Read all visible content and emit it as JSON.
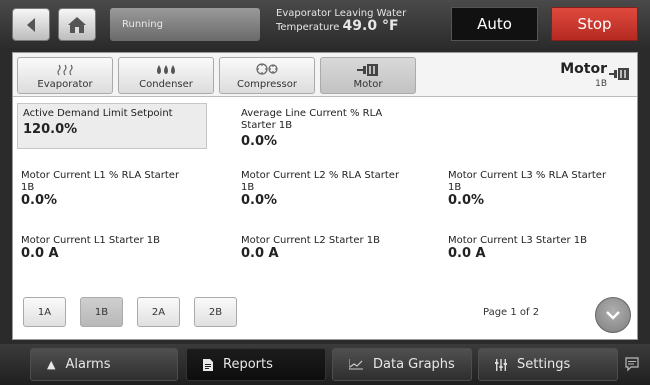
{
  "topbar": {
    "status": "Running",
    "evap_label_line1": "Evaporator Leaving Water",
    "evap_label_line2": "Temperature",
    "evap_value": "49.0 °F",
    "auto_label": "Auto",
    "stop_label": "Stop",
    "stop_color": "#cc3a30"
  },
  "tabs": [
    {
      "label": "Evaporator",
      "icon": "evaporator-icon"
    },
    {
      "label": "Condenser",
      "icon": "condenser-icon"
    },
    {
      "label": "Compressor",
      "icon": "compressor-icon"
    },
    {
      "label": "Motor",
      "icon": "motor-icon",
      "active": true
    }
  ],
  "component": {
    "title": "Motor",
    "subtitle": "1B"
  },
  "fields": {
    "active_demand_label": "Active Demand Limit Setpoint",
    "active_demand_value": "120.0%",
    "avg_line_label_1": "Average Line Current % RLA",
    "avg_line_label_2": "Starter 1B",
    "avg_line_value": "0.0%",
    "l1_rla_label_1": "Motor Current L1 % RLA Starter",
    "l1_rla_label_2": "1B",
    "l1_rla_value": "0.0%",
    "l2_rla_label_1": "Motor Current L2 % RLA Starter",
    "l2_rla_label_2": "1B",
    "l2_rla_value": "0.0%",
    "l3_rla_label_1": "Motor Current L3 % RLA Starter",
    "l3_rla_label_2": "1B",
    "l3_rla_value": "0.0%",
    "l1_amp_label": "Motor Current L1 Starter 1B",
    "l1_amp_value": "0.0 A",
    "l2_amp_label": "Motor Current L2 Starter 1B",
    "l2_amp_value": "0.0 A",
    "l3_amp_label": "Motor Current L3 Starter 1B",
    "l3_amp_value": "0.0 A"
  },
  "starters": [
    "1A",
    "1B",
    "2A",
    "2B"
  ],
  "active_starter": "1B",
  "pagination": {
    "text": "Page 1 of 2"
  },
  "bottombar": {
    "alarms": "Alarms",
    "reports": "Reports",
    "data_graphs": "Data Graphs",
    "settings": "Settings"
  }
}
